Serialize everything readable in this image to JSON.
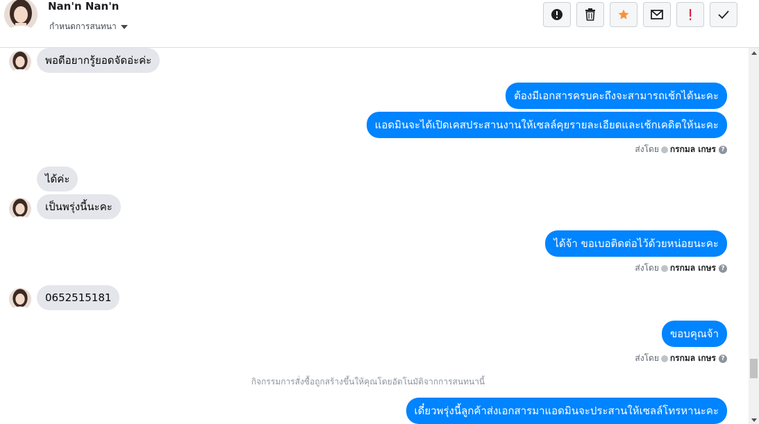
{
  "header": {
    "contact_name": "Nan'n Nan'n",
    "conversation_status": "กำหนดการสนทนา",
    "toolbar": [
      {
        "name": "mark-spam-button",
        "icon": "alert-circle-icon"
      },
      {
        "name": "delete-button",
        "icon": "trash-icon"
      },
      {
        "name": "star-button",
        "icon": "star-icon"
      },
      {
        "name": "mark-unread-button",
        "icon": "envelope-icon"
      },
      {
        "name": "follow-up-button",
        "icon": "exclamation-icon"
      },
      {
        "name": "mark-done-button",
        "icon": "checkmark-icon"
      }
    ]
  },
  "messages": {
    "m1": "พอดีอยากรู้ยอดจัดอ่ะค่ะ",
    "m2": "ต้องมีเอกสารครบคะถึงจะสามารถเช้กได้นะคะ",
    "m3": "แอดมินจะได้เปิดเคสประสานงานให้เซลล์คุยรายละเอียดและเช้กเคดิตให้นะคะ",
    "m4": "ได้ค่ะ",
    "m5": "เป็นพรุ่งนี้นะคะ",
    "m6": "ได้จ้า ขอเบอติดต่อไว้ด้วยหน่อยนะคะ",
    "m7": "0652515181",
    "m8": "ขอบคุณจ้า",
    "m9": "เดี๋ยวพรุ่งนี้ลูกค้าส่งเอกสารมาแอดมินจะประสานให้เซลล์โทรหานะคะ"
  },
  "sent_by": {
    "label": "ส่งโดย",
    "agent": "กรกมล เกษร",
    "help": "?"
  },
  "system_note": "กิจกรรมการสั่งซื้อถูกสร้างขึ้นให้คุณโดยอัตโนมัติจากการสนทนานี้",
  "colors": {
    "outgoing_bubble": "#0084ff",
    "incoming_bubble": "#e4e6eb",
    "star": "#f7923b",
    "follow_up": "#e41e3f"
  }
}
